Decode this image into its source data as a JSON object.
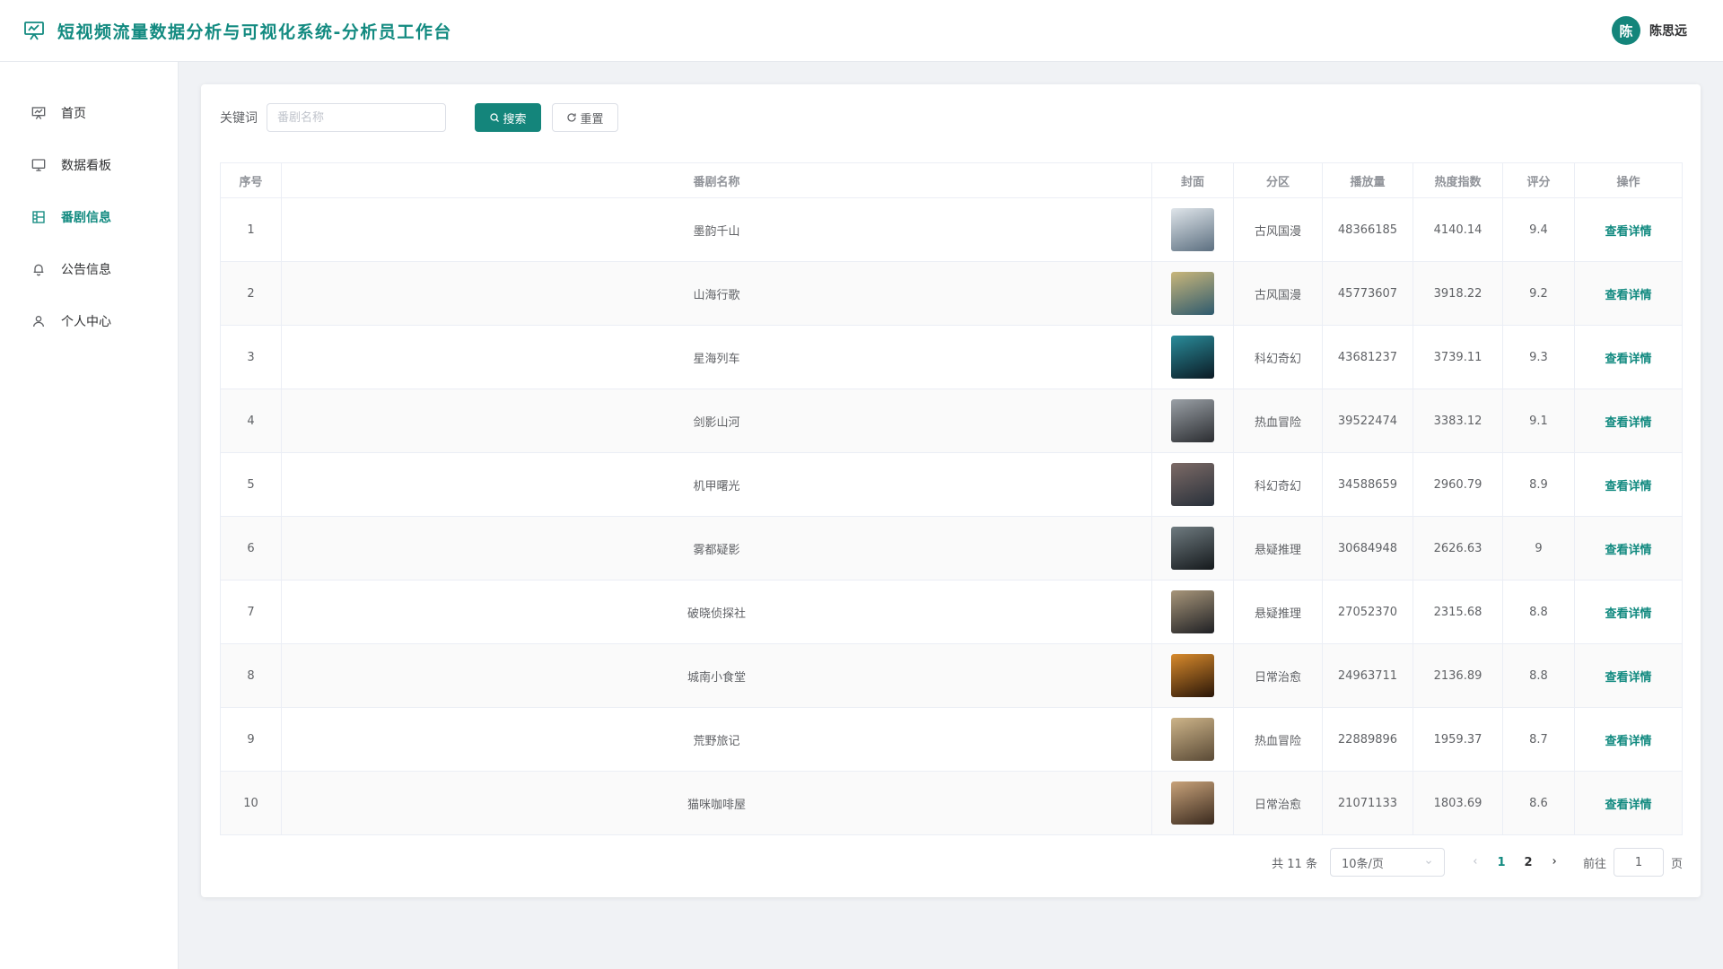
{
  "header": {
    "title": "短视频流量数据分析与可视化系统-分析员工作台",
    "user_initial": "陈",
    "user_name": "陈思远"
  },
  "sidebar": {
    "items": [
      {
        "label": "首页",
        "icon": "presentation-icon",
        "active": false
      },
      {
        "label": "数据看板",
        "icon": "monitor-icon",
        "active": false
      },
      {
        "label": "番剧信息",
        "icon": "film-grid-icon",
        "active": true
      },
      {
        "label": "公告信息",
        "icon": "bell-icon",
        "active": false
      },
      {
        "label": "个人中心",
        "icon": "user-icon",
        "active": false
      }
    ]
  },
  "search": {
    "label": "关键词",
    "placeholder": "番剧名称",
    "value": "",
    "search_button": "搜索",
    "reset_button": "重置"
  },
  "table": {
    "columns": [
      "序号",
      "番剧名称",
      "封面",
      "分区",
      "播放量",
      "热度指数",
      "评分",
      "操作"
    ],
    "rows": [
      {
        "index": "1",
        "name": "墨韵千山",
        "category": "古风国漫",
        "plays": "48366185",
        "heat": "4140.14",
        "rating": "9.4",
        "action": "查看详情",
        "cover": [
          "#dfe5ea",
          "#5c6f80"
        ]
      },
      {
        "index": "2",
        "name": "山海行歌",
        "category": "古风国漫",
        "plays": "45773607",
        "heat": "3918.22",
        "rating": "9.2",
        "action": "查看详情",
        "cover": [
          "#c9b67a",
          "#2e5a6e"
        ]
      },
      {
        "index": "3",
        "name": "星海列车",
        "category": "科幻奇幻",
        "plays": "43681237",
        "heat": "3739.11",
        "rating": "9.3",
        "action": "查看详情",
        "cover": [
          "#2a8c9a",
          "#0b1a24"
        ]
      },
      {
        "index": "4",
        "name": "剑影山河",
        "category": "热血冒险",
        "plays": "39522474",
        "heat": "3383.12",
        "rating": "9.1",
        "action": "查看详情",
        "cover": [
          "#9aa0a6",
          "#2b2d31"
        ]
      },
      {
        "index": "5",
        "name": "机甲曙光",
        "category": "科幻奇幻",
        "plays": "34588659",
        "heat": "2960.79",
        "rating": "8.9",
        "action": "查看详情",
        "cover": [
          "#7c6a66",
          "#28303a"
        ]
      },
      {
        "index": "6",
        "name": "雾都疑影",
        "category": "悬疑推理",
        "plays": "30684948",
        "heat": "2626.63",
        "rating": "9",
        "action": "查看详情",
        "cover": [
          "#6f7b80",
          "#15191c"
        ]
      },
      {
        "index": "7",
        "name": "破晓侦探社",
        "category": "悬疑推理",
        "plays": "27052370",
        "heat": "2315.68",
        "rating": "8.8",
        "action": "查看详情",
        "cover": [
          "#a8967a",
          "#1f2024"
        ]
      },
      {
        "index": "8",
        "name": "城南小食堂",
        "category": "日常治愈",
        "plays": "24963711",
        "heat": "2136.89",
        "rating": "8.8",
        "action": "查看详情",
        "cover": [
          "#d88a2c",
          "#2a1608"
        ]
      },
      {
        "index": "9",
        "name": "荒野旅记",
        "category": "热血冒险",
        "plays": "22889896",
        "heat": "1959.37",
        "rating": "8.7",
        "action": "查看详情",
        "cover": [
          "#cdb489",
          "#5a4a36"
        ]
      },
      {
        "index": "10",
        "name": "猫咪咖啡屋",
        "category": "日常治愈",
        "plays": "21071133",
        "heat": "1803.69",
        "rating": "8.6",
        "action": "查看详情",
        "cover": [
          "#c8a27a",
          "#3a2a1e"
        ]
      }
    ]
  },
  "pagination": {
    "total": "共 11 条",
    "page_size": "10条/页",
    "pages": [
      "1",
      "2"
    ],
    "current_page": "1",
    "goto_label": "前往",
    "goto_value": "1",
    "page_suffix": "页"
  },
  "colors": {
    "accent": "#128a80",
    "primary_button": "#14857b"
  }
}
